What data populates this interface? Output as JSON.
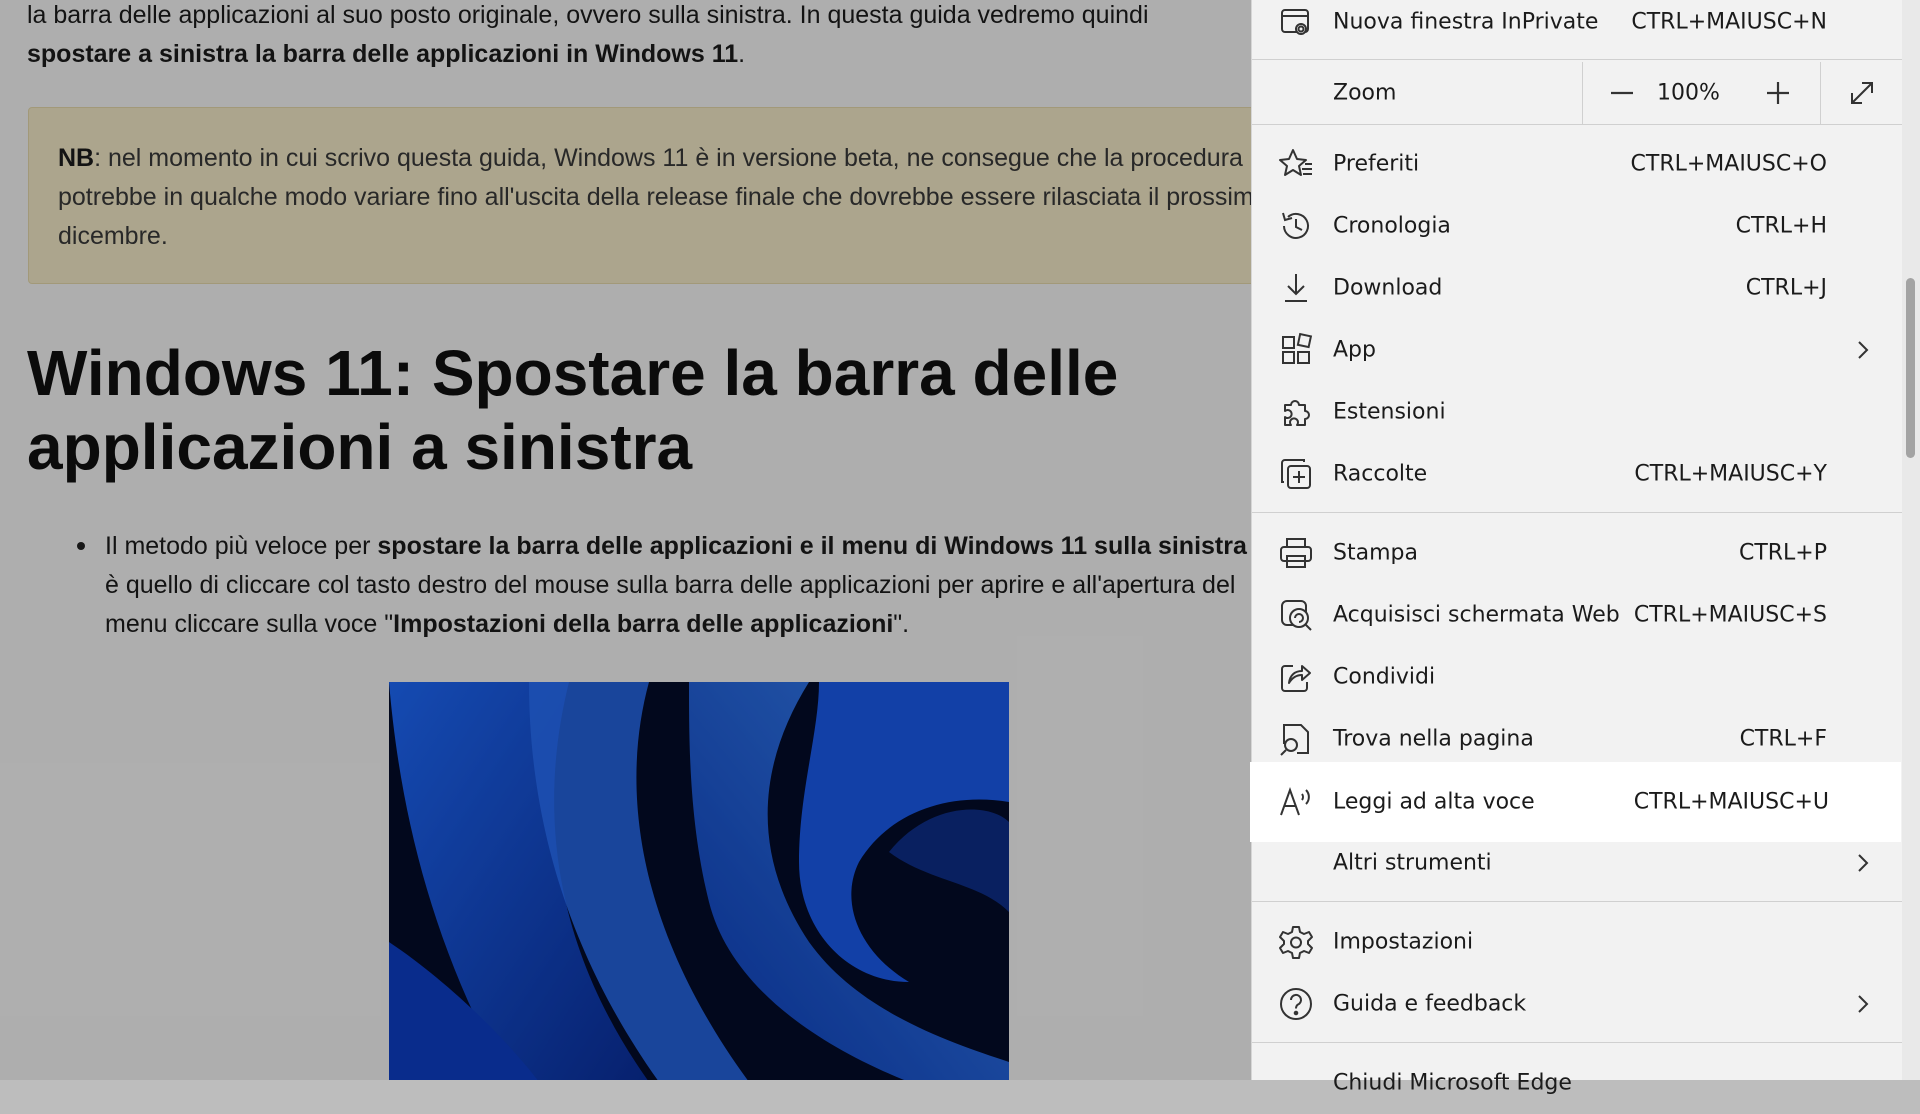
{
  "article": {
    "intro_line1": "la barra delle applicazioni al suo posto originale, ovvero sulla sinistra. In questa guida vedremo quindi",
    "intro_bold": "spostare a sinistra la barra delle applicazioni in Windows 11",
    "intro_end": ".",
    "note_bold": "NB",
    "note_text": ": nel momento in cui scrivo questa guida, Windows 11 è in versione beta, ne consegue che la procedura potrebbe in qualche modo variare fino all'uscita della release finale che dovrebbe essere rilasciata il prossimo dicembre.",
    "heading": "Windows 11: Spostare la barra delle applicazioni a sinistra",
    "bullet_part1": "Il metodo più veloce per ",
    "bullet_bold1": "spostare  la barra delle applicazioni e il menu di Windows 11 sulla sinistra",
    "bullet_part2": " è quello di cliccare col tasto destro del mouse sulla barra delle applicazioni per aprire e all'apertura del menu cliccare sulla voce \"",
    "bullet_bold2": "Impostazioni della barra delle applicazioni",
    "bullet_part3": "\"."
  },
  "menu": {
    "inprivate": {
      "label": "Nuova finestra InPrivate",
      "shortcut": "CTRL+MAIUSC+N"
    },
    "zoom": {
      "label": "Zoom",
      "value": "100%"
    },
    "items": [
      {
        "label": "Preferiti",
        "shortcut": "CTRL+MAIUSC+O",
        "icon": "favorites-star-icon"
      },
      {
        "label": "Cronologia",
        "shortcut": "CTRL+H",
        "icon": "history-icon"
      },
      {
        "label": "Download",
        "shortcut": "CTRL+J",
        "icon": "download-icon"
      },
      {
        "label": "App",
        "shortcut": "",
        "icon": "apps-icon"
      },
      {
        "label": "Estensioni",
        "shortcut": "",
        "icon": "extensions-puzzle-icon"
      },
      {
        "label": "Raccolte",
        "shortcut": "CTRL+MAIUSC+Y",
        "icon": "collections-icon"
      },
      {
        "label": "Stampa",
        "shortcut": "CTRL+P",
        "icon": "printer-icon"
      },
      {
        "label": "Acquisisci schermata Web",
        "shortcut": "CTRL+MAIUSC+S",
        "icon": "web-capture-icon"
      },
      {
        "label": "Condividi",
        "shortcut": "",
        "icon": "share-icon"
      },
      {
        "label": "Trova nella pagina",
        "shortcut": "CTRL+F",
        "icon": "find-in-page-icon"
      },
      {
        "label": "Leggi ad alta voce",
        "shortcut": "CTRL+MAIUSC+U",
        "icon": "read-aloud-icon"
      },
      {
        "label": "Altri strumenti",
        "shortcut": "",
        "icon": ""
      },
      {
        "label": "Impostazioni",
        "shortcut": "",
        "icon": "settings-gear-icon"
      },
      {
        "label": "Guida e feedback",
        "shortcut": "",
        "icon": "help-question-icon"
      },
      {
        "label": "Chiudi Microsoft Edge",
        "shortcut": "",
        "icon": ""
      }
    ],
    "highlighted": "Leggi ad alta voce",
    "highlight_color": "#ffffff",
    "menu_background": "#f2f2f2"
  }
}
